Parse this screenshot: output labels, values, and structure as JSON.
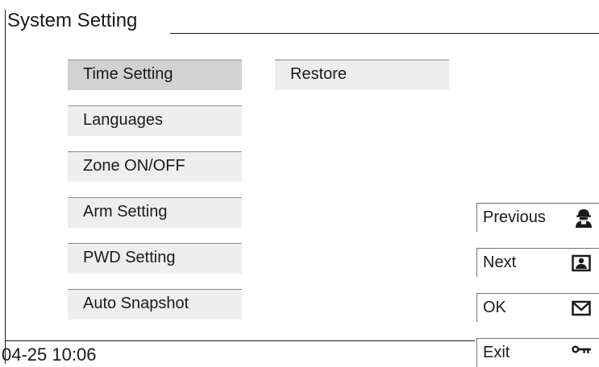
{
  "window": {
    "title": "System Setting"
  },
  "menu": {
    "items": [
      {
        "label": "Time Setting",
        "selected": true
      },
      {
        "label": "Languages",
        "selected": false
      },
      {
        "label": "Zone ON/OFF",
        "selected": false
      },
      {
        "label": "Arm Setting",
        "selected": false
      },
      {
        "label": "PWD Setting",
        "selected": false
      },
      {
        "label": "Auto Snapshot",
        "selected": false
      }
    ],
    "restore_label": "Restore"
  },
  "side_buttons": {
    "previous": {
      "label": "Previous",
      "icon": "person-icon"
    },
    "next": {
      "label": "Next",
      "icon": "picture-icon"
    },
    "ok": {
      "label": "OK",
      "icon": "envelope-icon"
    },
    "exit": {
      "label": "Exit",
      "icon": "key-icon"
    }
  },
  "status": {
    "date": "04-25",
    "time": "10:06"
  },
  "colors": {
    "selected_item": "#d2d2d2",
    "item_background": "#eeeeee",
    "text": "#1a1a1a"
  }
}
